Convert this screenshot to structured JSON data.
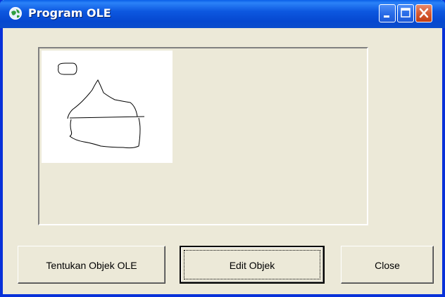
{
  "window": {
    "title": "Program OLE",
    "icon": "globe-app-icon"
  },
  "titlebar_controls": {
    "minimize_icon": "minimize-icon",
    "maximize_icon": "maximize-icon",
    "close_icon": "close-icon"
  },
  "ole_container": {
    "content": "embedded-drawing-object"
  },
  "buttons": {
    "choose_ole_label": "Tentukan Objek OLE",
    "edit_label": "Edit Objek",
    "close_label": "Close"
  },
  "colors": {
    "titlebar": "#0a4ccc",
    "window_face": "#ece9d8",
    "close_button": "#d65a32"
  }
}
